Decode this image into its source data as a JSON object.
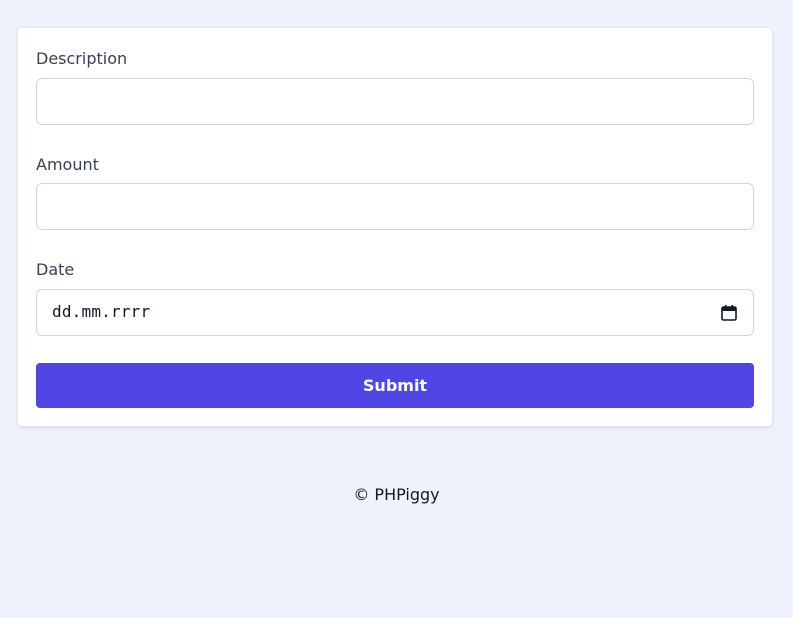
{
  "form": {
    "description": {
      "label": "Description",
      "value": ""
    },
    "amount": {
      "label": "Amount",
      "value": ""
    },
    "date": {
      "label": "Date",
      "placeholder": "dd.mm.rrrr"
    },
    "submit_label": "Submit"
  },
  "footer": {
    "text": "© PHPiggy"
  },
  "colors": {
    "background": "#eef2fd",
    "accent": "#4f46e5",
    "label": "#374151"
  },
  "icons": {
    "date_picker": "calendar-icon"
  }
}
